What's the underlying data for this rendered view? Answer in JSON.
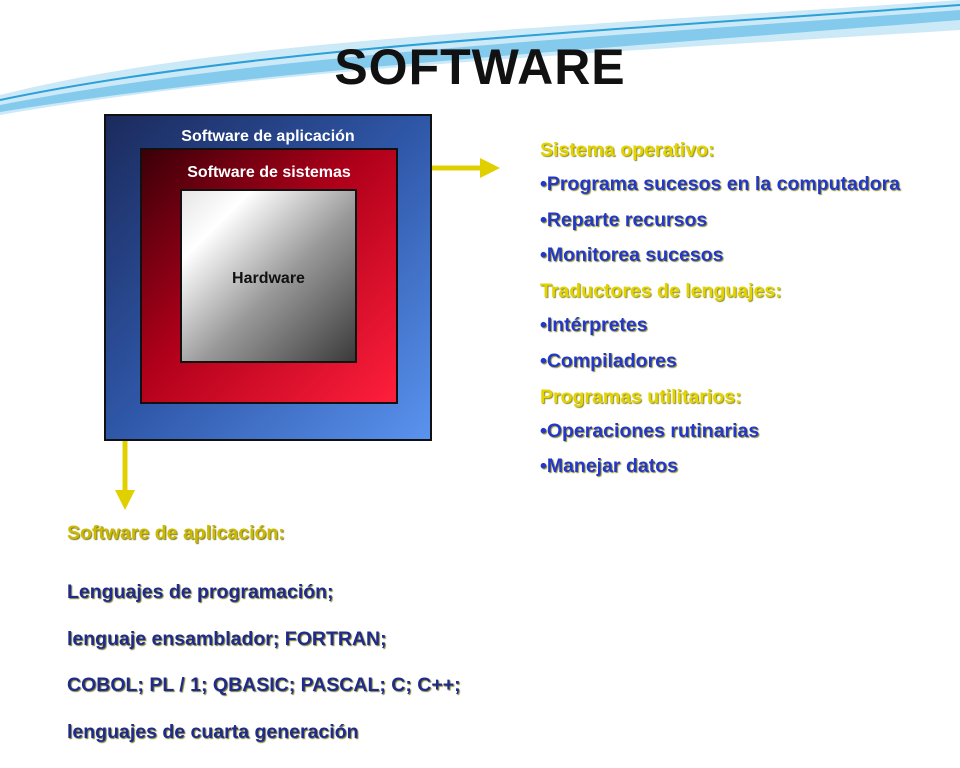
{
  "title": "SOFTWARE",
  "diagram": {
    "outer_label": "Software de aplicación",
    "middle_label": "Software de sistemas",
    "inner_label": "Hardware"
  },
  "right_panel": {
    "sections": [
      {
        "heading": "Sistema operativo:",
        "items": [
          "Programa sucesos en la computadora",
          "Reparte recursos",
          "Monitorea sucesos"
        ]
      },
      {
        "heading": "Traductores de lenguajes:",
        "items": [
          "Intérpretes",
          "Compiladores"
        ]
      },
      {
        "heading": "Programas utilitarios:",
        "items": [
          "Operaciones rutinarias",
          "Manejar datos"
        ]
      }
    ]
  },
  "bottom_panel": {
    "heading": "Software de aplicación:",
    "lines": [
      "Lenguajes de programación;",
      "lenguaje ensamblador; FORTRAN;",
      "COBOL; PL / 1; QBASIC; PASCAL; C; C++;",
      "lenguajes de cuarta generación"
    ]
  },
  "colors": {
    "arrow": "#e0d000",
    "heading": "#e3d400",
    "item": "#2338c8",
    "outer_box": "#3b6cc9",
    "middle_box": "#d0001f"
  }
}
